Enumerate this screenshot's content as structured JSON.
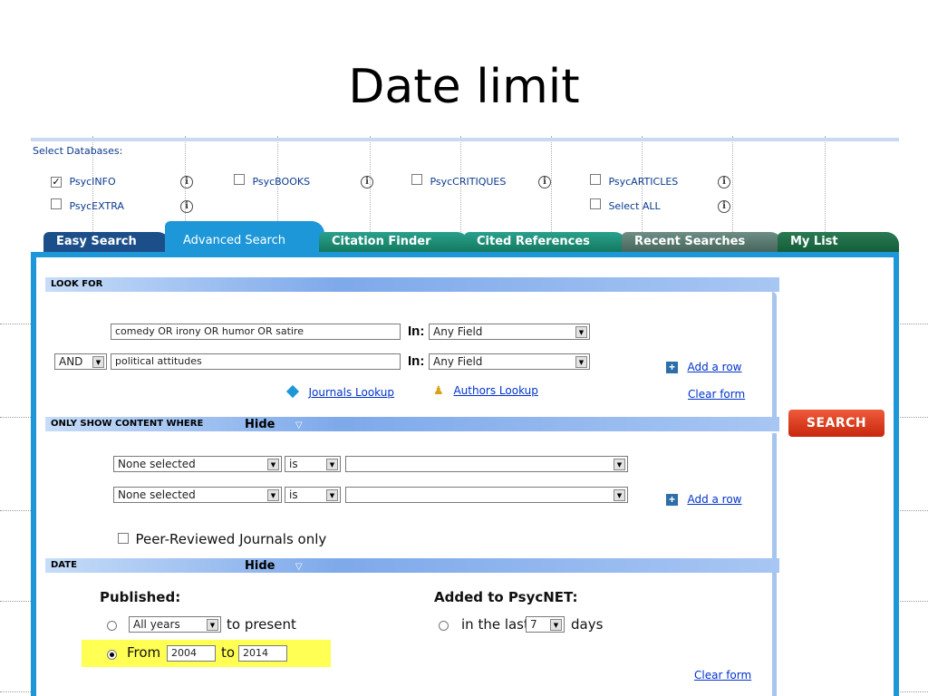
{
  "slide": {
    "title": "Date limit"
  },
  "databases": {
    "label": "Select Databases:",
    "items": [
      {
        "name": "PsycINFO",
        "checked": true
      },
      {
        "name": "PsycBOOKS",
        "checked": false
      },
      {
        "name": "PsycCRITIQUES",
        "checked": false
      },
      {
        "name": "PsycARTICLES",
        "checked": false
      },
      {
        "name": "PsycEXTRA",
        "checked": false
      },
      {
        "name": "Select ALL",
        "checked": false
      }
    ]
  },
  "tabs": [
    {
      "label": "Easy Search"
    },
    {
      "label": "Advanced Search",
      "active": true
    },
    {
      "label": "Citation Finder"
    },
    {
      "label": "Cited References"
    },
    {
      "label": "Recent Searches"
    },
    {
      "label": "My List"
    }
  ],
  "look_for": {
    "header": "LOOK FOR",
    "row1": {
      "value": "comedy OR irony OR humor OR satire",
      "in_label": "In:",
      "field": "Any Field"
    },
    "row2": {
      "operator": "AND",
      "value": "political attitudes",
      "in_label": "In:",
      "field": "Any Field"
    },
    "journals_lookup": "Journals Lookup",
    "authors_lookup": "Authors Lookup",
    "add_row": "Add a row",
    "clear_form": "Clear form"
  },
  "only_show": {
    "header": "ONLY SHOW CONTENT WHERE",
    "hide": "Hide",
    "rows": [
      {
        "field": "None selected",
        "op": "is",
        "value": ""
      },
      {
        "field": "None selected",
        "op": "is",
        "value": ""
      }
    ],
    "add_row": "Add a row",
    "peer_reviewed": "Peer-Reviewed Journals only"
  },
  "date": {
    "header": "DATE",
    "hide": "Hide",
    "published_label": "Published:",
    "all_years": "All years",
    "to_present": "to present",
    "from_label": "From",
    "from_value": "2004",
    "to_label": "to",
    "to_value": "2014",
    "added_label": "Added to PsycNET:",
    "in_the_last": "in the last",
    "days_value": "7",
    "days_label": "days",
    "clear_form": "Clear form"
  },
  "search_button": "SEARCH",
  "colors": {
    "tab_blue": "#1d97d8",
    "tab_dark": "#1c4f8a",
    "tab_green": "#14795f",
    "search_red": "#c8270c",
    "highlight": "#ffff54"
  }
}
